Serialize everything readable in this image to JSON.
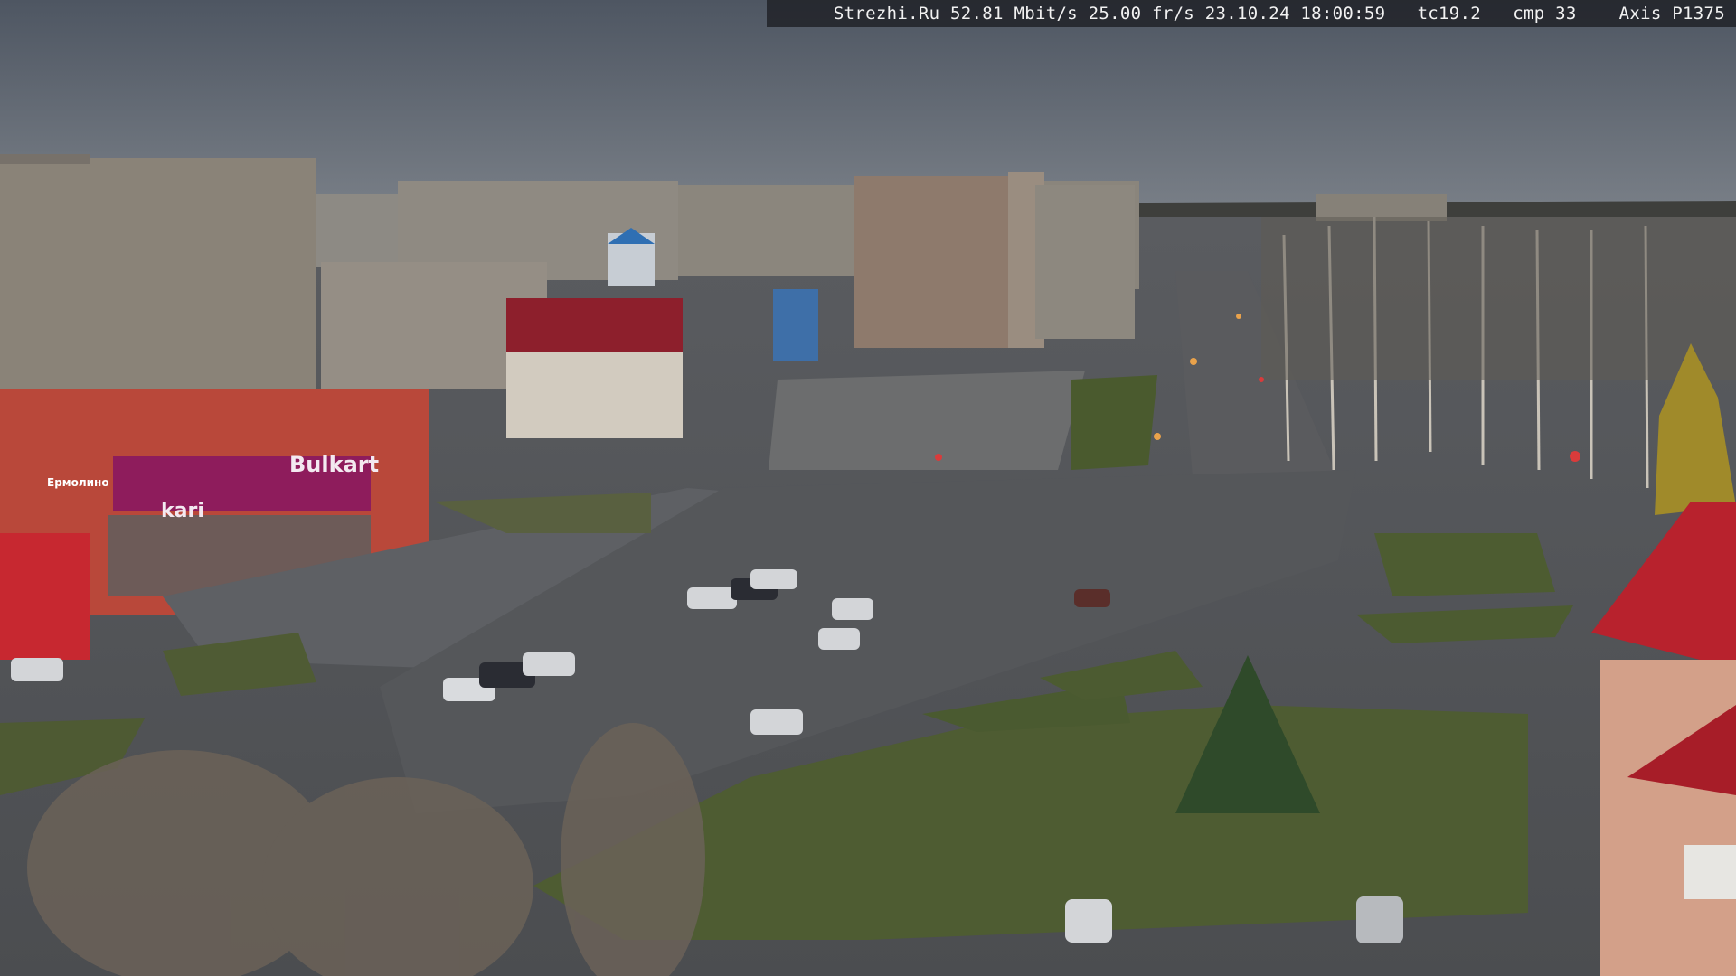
{
  "camera_overlay": {
    "text": "Strezhi.Ru 52.81 Mbit/s 25.00 fr/s 23.10.24 18:00:59   tc19.2   cmp 33    Axis P1375"
  },
  "storefront_signs": {
    "main": "Bulkart",
    "left": "kari",
    "small": "Ермолино"
  },
  "colors": {
    "sky": "#59616d",
    "asphalt": "#5e6064",
    "grass": "#4e5c32",
    "panel_building": "#8a8378",
    "storefront": "#b9483a",
    "sign_magenta": "#8e1c5c",
    "tower_red": "#b8222d"
  }
}
